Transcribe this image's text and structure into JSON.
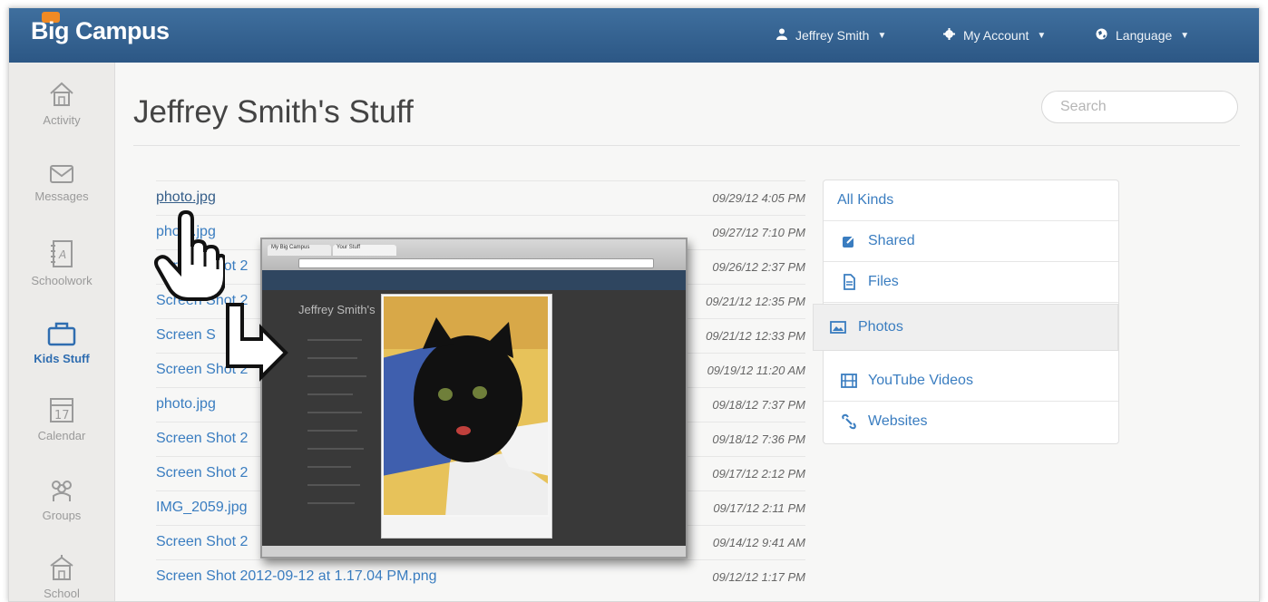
{
  "topbar": {
    "logo": "Big Campus",
    "user_label": "Jeffrey Smith",
    "account_label": "My Account",
    "language_label": "Language"
  },
  "sidebar": {
    "items": [
      {
        "label": "Activity",
        "icon": "house-icon"
      },
      {
        "label": "Messages",
        "icon": "envelope-icon"
      },
      {
        "label": "Schoolwork",
        "icon": "notebook-icon"
      },
      {
        "label": "Kids Stuff",
        "icon": "locker-icon"
      },
      {
        "label": "Calendar",
        "icon": "calendar-icon",
        "calendar_day": "17"
      },
      {
        "label": "Groups",
        "icon": "groups-icon"
      },
      {
        "label": "School",
        "icon": "school-icon"
      }
    ]
  },
  "main": {
    "title": "Jeffrey Smith's Stuff",
    "search_placeholder": "Search"
  },
  "files": [
    {
      "name": "photo.jpg",
      "date": "09/29/12 4:05 PM"
    },
    {
      "name": "photo.jpg",
      "date": "09/27/12 7:10 PM"
    },
    {
      "name": "Screen Shot 2",
      "date": "09/26/12 2:37 PM"
    },
    {
      "name": "Screen Shot 2",
      "date": "09/21/12 12:35 PM"
    },
    {
      "name": "Screen S",
      "date": "09/21/12 12:33 PM"
    },
    {
      "name": "Screen Shot 2",
      "date": "09/19/12 11:20 AM"
    },
    {
      "name": "photo.jpg",
      "date": "09/18/12 7:37 PM"
    },
    {
      "name": "Screen Shot 2",
      "date": "09/18/12 7:36 PM"
    },
    {
      "name": "Screen Shot 2",
      "date": "09/17/12 2:12 PM"
    },
    {
      "name": "IMG_2059.jpg",
      "date": "09/17/12 2:11 PM"
    },
    {
      "name": "Screen Shot 2",
      "date": "09/14/12 9:41 AM"
    },
    {
      "name": "Screen Shot 2012-09-12 at 1.17.04 PM.png",
      "date": "09/12/12 1:17 PM"
    }
  ],
  "kinds": [
    {
      "label": "All Kinds",
      "icon": ""
    },
    {
      "label": "Shared",
      "icon": "share-icon"
    },
    {
      "label": "Files",
      "icon": "file-icon"
    },
    {
      "label": "Photos",
      "icon": "photo-icon"
    },
    {
      "label": "YouTube Videos",
      "icon": "film-icon"
    },
    {
      "label": "Websites",
      "icon": "link-icon"
    }
  ],
  "popup": {
    "tab1": "My Big Campus",
    "tab2": "Your Stuff",
    "inner_title": "Jeffrey Smith's"
  },
  "colors": {
    "topbar": "#3a6795",
    "link": "#3a7dc0",
    "active_sidebar": "#2f6db0"
  }
}
